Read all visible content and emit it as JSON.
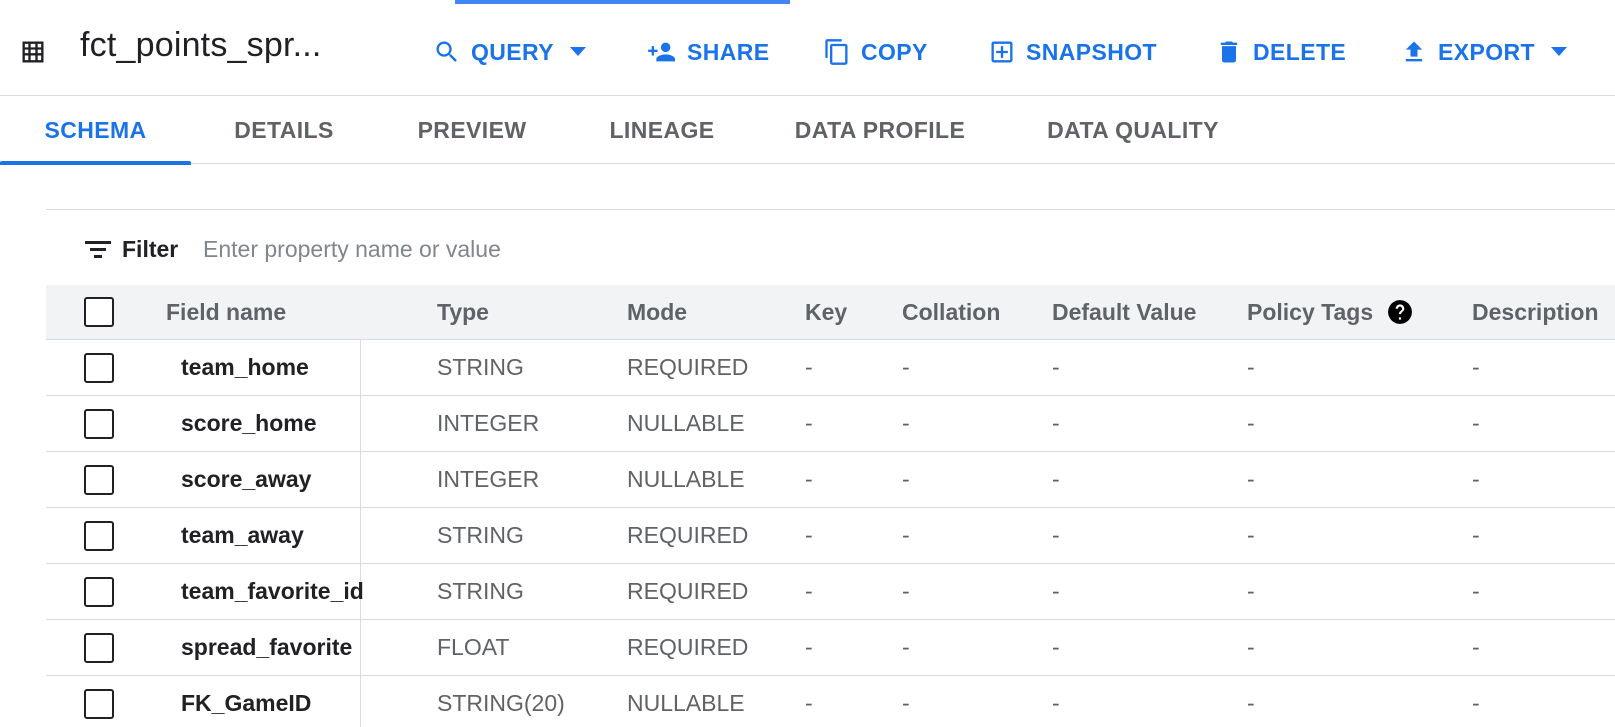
{
  "header": {
    "title": "fct_points_spr..."
  },
  "toolbar": {
    "query_label": "QUERY",
    "share_label": "SHARE",
    "copy_label": "COPY",
    "snapshot_label": "SNAPSHOT",
    "delete_label": "DELETE",
    "export_label": "EXPORT"
  },
  "tabs": [
    {
      "label": "SCHEMA",
      "active": true
    },
    {
      "label": "DETAILS"
    },
    {
      "label": "PREVIEW"
    },
    {
      "label": "LINEAGE"
    },
    {
      "label": "DATA PROFILE"
    },
    {
      "label": "DATA QUALITY"
    }
  ],
  "filter": {
    "label": "Filter",
    "placeholder": "Enter property name or value"
  },
  "schema_table": {
    "columns": [
      "Field name",
      "Type",
      "Mode",
      "Key",
      "Collation",
      "Default Value",
      "Policy Tags",
      "Description"
    ],
    "rows": [
      {
        "field": "team_home",
        "type": "STRING",
        "mode": "REQUIRED",
        "key": "-",
        "collation": "-",
        "default": "-",
        "policy": "-",
        "description": "-"
      },
      {
        "field": "score_home",
        "type": "INTEGER",
        "mode": "NULLABLE",
        "key": "-",
        "collation": "-",
        "default": "-",
        "policy": "-",
        "description": "-"
      },
      {
        "field": "score_away",
        "type": "INTEGER",
        "mode": "NULLABLE",
        "key": "-",
        "collation": "-",
        "default": "-",
        "policy": "-",
        "description": "-"
      },
      {
        "field": "team_away",
        "type": "STRING",
        "mode": "REQUIRED",
        "key": "-",
        "collation": "-",
        "default": "-",
        "policy": "-",
        "description": "-"
      },
      {
        "field": "team_favorite_id",
        "type": "STRING",
        "mode": "REQUIRED",
        "key": "-",
        "collation": "-",
        "default": "-",
        "policy": "-",
        "description": "-"
      },
      {
        "field": "spread_favorite",
        "type": "FLOAT",
        "mode": "REQUIRED",
        "key": "-",
        "collation": "-",
        "default": "-",
        "policy": "-",
        "description": "-"
      },
      {
        "field": "FK_GameID",
        "type": "STRING(20)",
        "mode": "NULLABLE",
        "key": "-",
        "collation": "-",
        "default": "-",
        "policy": "-",
        "description": "-"
      }
    ]
  },
  "colors": {
    "accent": "#1a73e8",
    "text": "#202124",
    "muted": "#5f6368",
    "header_bg": "#f1f3f4",
    "divider": "#dadce0"
  },
  "icons": {
    "title": "table-icon",
    "query": "search-icon",
    "share": "person-add-icon",
    "copy": "copy-icon",
    "snapshot": "snapshot-icon",
    "delete": "trash-icon",
    "export": "upload-icon",
    "filter": "filter-icon",
    "policy_help": "help-icon"
  }
}
